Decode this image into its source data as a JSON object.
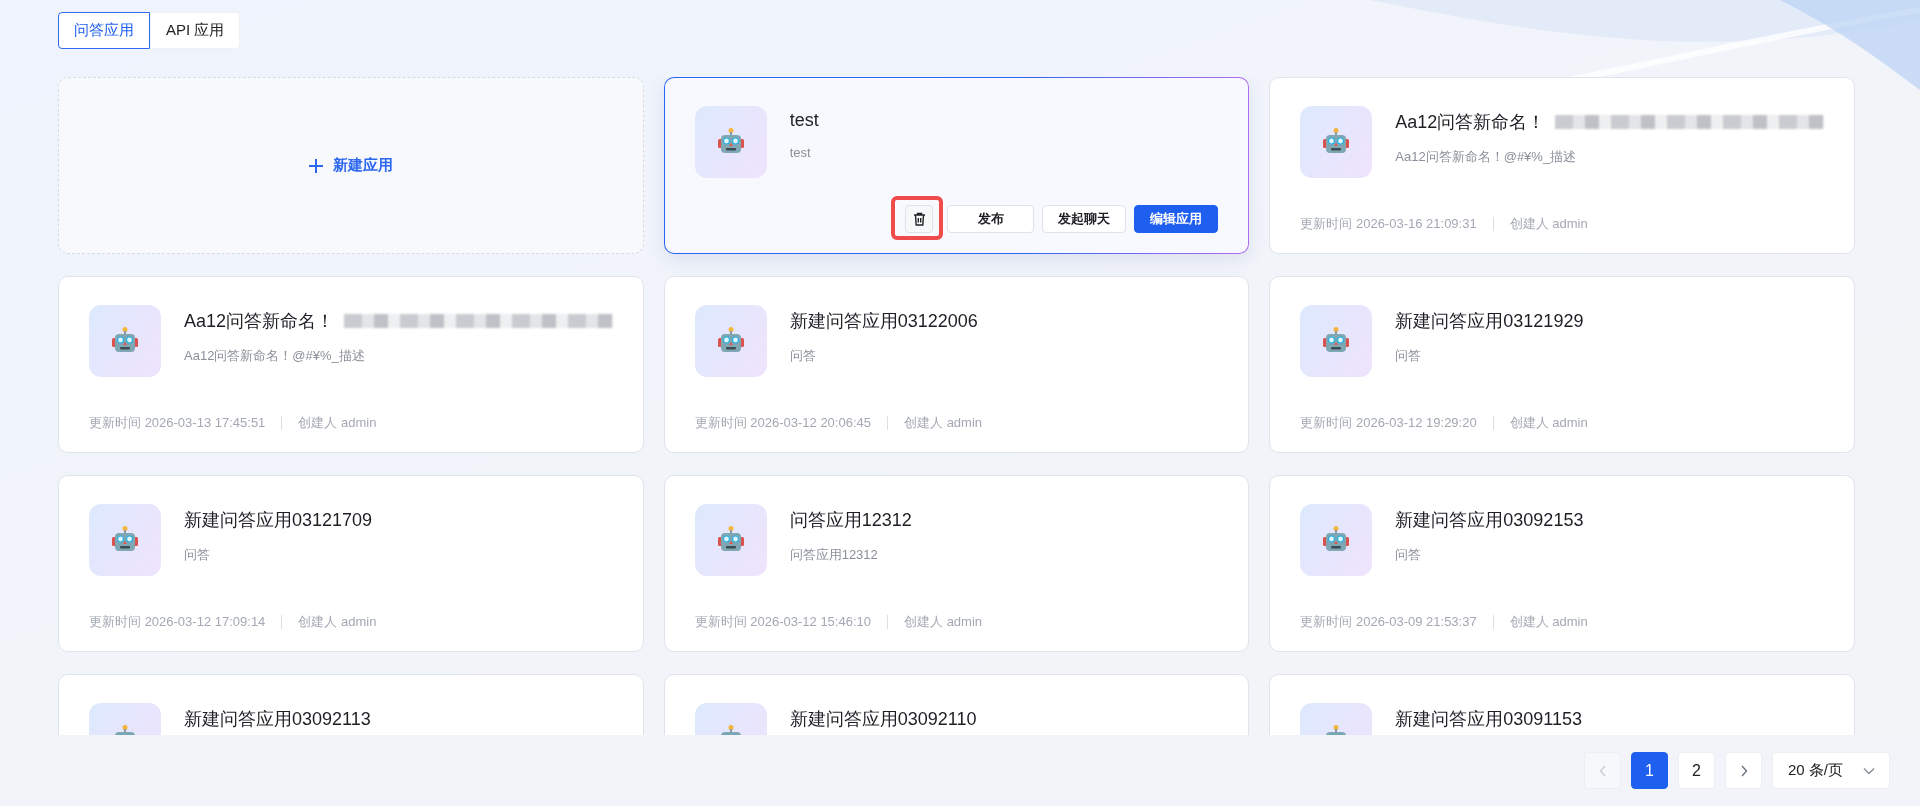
{
  "tabs": [
    {
      "label": "问答应用",
      "selected": true
    },
    {
      "label": "API 应用",
      "selected": false
    }
  ],
  "cards": [
    {
      "kind": "create",
      "label": "新建应用"
    },
    {
      "kind": "app",
      "title": "test",
      "redacted": false,
      "description": "test",
      "hovered": true,
      "actions": [
        {
          "kind": "icon",
          "highlighted": true
        },
        {
          "kind": "default",
          "label": "发布"
        },
        {
          "kind": "default",
          "label": "发起聊天"
        },
        {
          "kind": "primary",
          "label": "编辑应用"
        }
      ]
    },
    {
      "kind": "app",
      "title": "Aa12问答新命名！",
      "redacted": true,
      "description": "Aa12问答新命名！@#¥%_描述",
      "hovered": false,
      "updated_label": "更新时间",
      "updated": "2026-03-16 21:09:31",
      "creator_label": "创建人",
      "creator": "admin"
    },
    {
      "kind": "app",
      "title": "Aa12问答新命名！",
      "redacted": true,
      "description": "Aa12问答新命名！@#¥%_描述",
      "hovered": false,
      "updated_label": "更新时间",
      "updated": "2026-03-13 17:45:51",
      "creator_label": "创建人",
      "creator": "admin"
    },
    {
      "kind": "app",
      "title": "新建问答应用03122006",
      "redacted": false,
      "description": "问答",
      "hovered": false,
      "updated_label": "更新时间",
      "updated": "2026-03-12 20:06:45",
      "creator_label": "创建人",
      "creator": "admin"
    },
    {
      "kind": "app",
      "title": "新建问答应用03121929",
      "redacted": false,
      "description": "问答",
      "hovered": false,
      "updated_label": "更新时间",
      "updated": "2026-03-12 19:29:20",
      "creator_label": "创建人",
      "creator": "admin"
    },
    {
      "kind": "app",
      "title": "新建问答应用03121709",
      "redacted": false,
      "description": "问答",
      "hovered": false,
      "updated_label": "更新时间",
      "updated": "2026-03-12 17:09:14",
      "creator_label": "创建人",
      "creator": "admin"
    },
    {
      "kind": "app",
      "title": "问答应用12312",
      "redacted": false,
      "description": "问答应用12312",
      "hovered": false,
      "updated_label": "更新时间",
      "updated": "2026-03-12 15:46:10",
      "creator_label": "创建人",
      "creator": "admin"
    },
    {
      "kind": "app",
      "title": "新建问答应用03092153",
      "redacted": false,
      "description": "问答",
      "hovered": false,
      "updated_label": "更新时间",
      "updated": "2026-03-09 21:53:37",
      "creator_label": "创建人",
      "creator": "admin"
    },
    {
      "kind": "app",
      "title": "新建问答应用03092113",
      "redacted": false,
      "hovered": false
    },
    {
      "kind": "app",
      "title": "新建问答应用03092110",
      "redacted": false,
      "hovered": false
    },
    {
      "kind": "app",
      "title": "新建问答应用03091153",
      "redacted": false,
      "hovered": false
    }
  ],
  "pagination": {
    "pages": [
      {
        "label": "1",
        "selected": true
      },
      {
        "label": "2",
        "selected": false
      }
    ],
    "prev_disabled": true,
    "next_disabled": false,
    "page_size": "20 条/页"
  }
}
